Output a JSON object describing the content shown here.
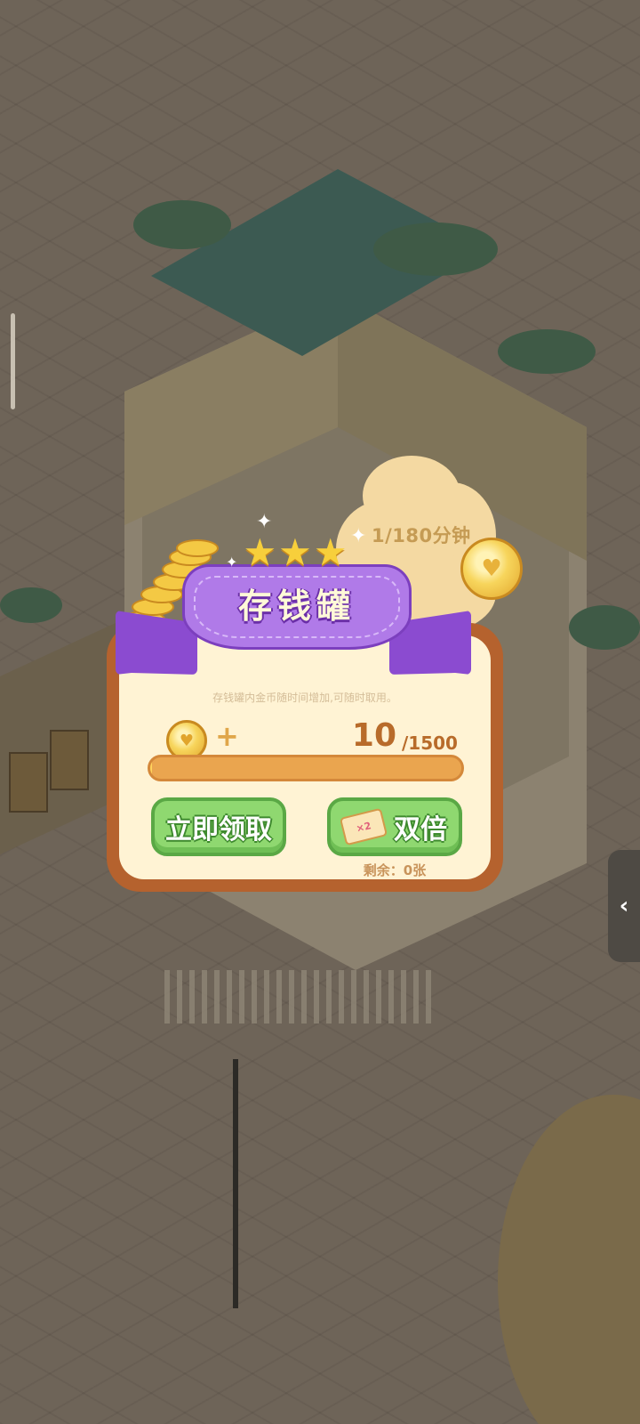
{
  "popup": {
    "title": "存钱罐",
    "timer": "1/180分钟",
    "subtitle": "存钱罐内金币随时间增加,可随时取用。",
    "plus_sign": "+",
    "coin_count": "10",
    "coin_max": "/1500",
    "progress_fraction": 0.0067,
    "claim_button": "立即领取",
    "double_button": "双倍",
    "ticket_label": "双倍",
    "remaining": "剩余：0张",
    "stars": [
      "★",
      "★",
      "★"
    ]
  },
  "colors": {
    "ribbon": "#b07ae8",
    "card_border": "#b5622e",
    "card_bg": "#fff3d4",
    "button_green": "#8fd870",
    "progress_bar": "#eaa54f",
    "coin_gold": "#f7d55c"
  },
  "icons": {
    "edge_tab": "chevron-left-icon",
    "coin": "heart-coin-icon",
    "ticket": "double-ticket-icon"
  }
}
